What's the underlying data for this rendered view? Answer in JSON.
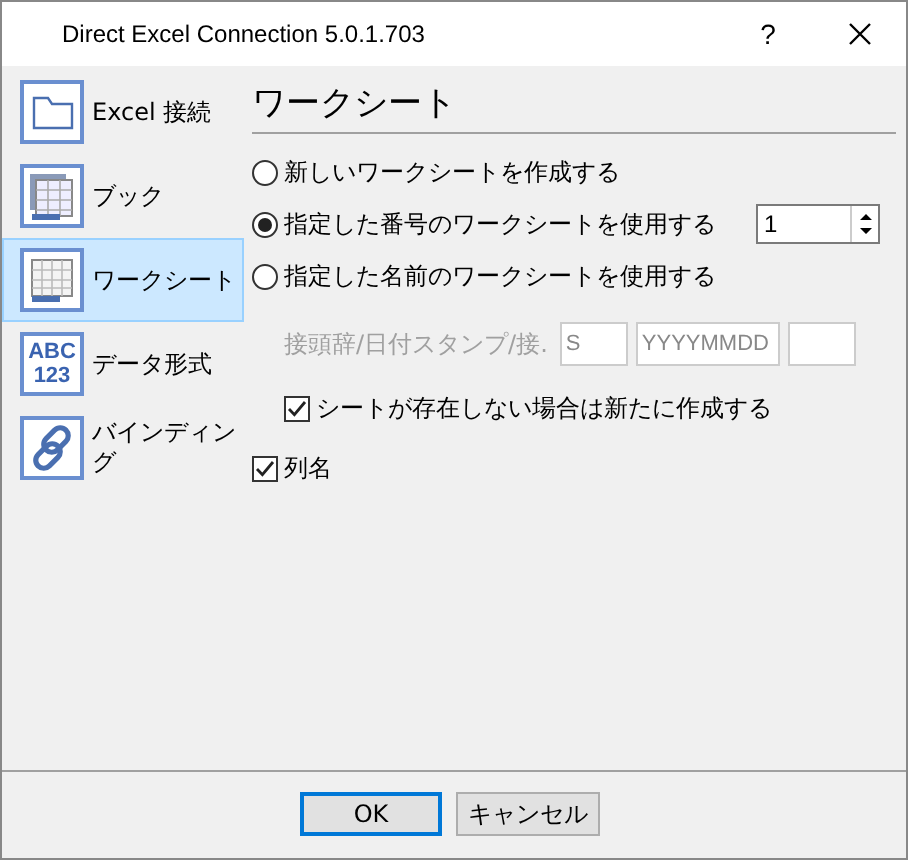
{
  "window": {
    "title": "Direct Excel Connection 5.0.1.703",
    "help": "?"
  },
  "sidebar": {
    "items": [
      {
        "label": "Excel 接続",
        "kind": "folder",
        "selected": false
      },
      {
        "label": "ブック",
        "kind": "book",
        "selected": false
      },
      {
        "label": "ワークシート",
        "kind": "sheet",
        "selected": true
      },
      {
        "label": "データ形式",
        "kind": "abc",
        "icon_text": [
          "ABC",
          "123"
        ],
        "selected": false
      },
      {
        "label": "バインディング",
        "kind": "link",
        "selected": false
      }
    ]
  },
  "panel": {
    "title": "ワークシート",
    "radios": [
      {
        "label": "新しいワークシートを作成する",
        "selected": false
      },
      {
        "label": "指定した番号のワークシートを使用する",
        "selected": true,
        "spinner": "1"
      },
      {
        "label": "指定した名前のワークシートを使用する",
        "selected": false
      }
    ],
    "prefix_row": {
      "label": "接頭辞/日付スタンプ/接.",
      "disabled": true,
      "fields": [
        {
          "value": "S",
          "disabled": true
        },
        {
          "value": "YYYYMMDD",
          "disabled": true
        },
        {
          "disabled": true
        }
      ]
    },
    "create_if_missing": {
      "label": "シートが存在しない場合は新たに作成する",
      "checked": true
    },
    "column_names": {
      "label": "列名",
      "checked": true
    }
  },
  "buttons": [
    {
      "label": "OK",
      "default": true
    },
    {
      "label": "キャンセル",
      "default": false
    }
  ]
}
